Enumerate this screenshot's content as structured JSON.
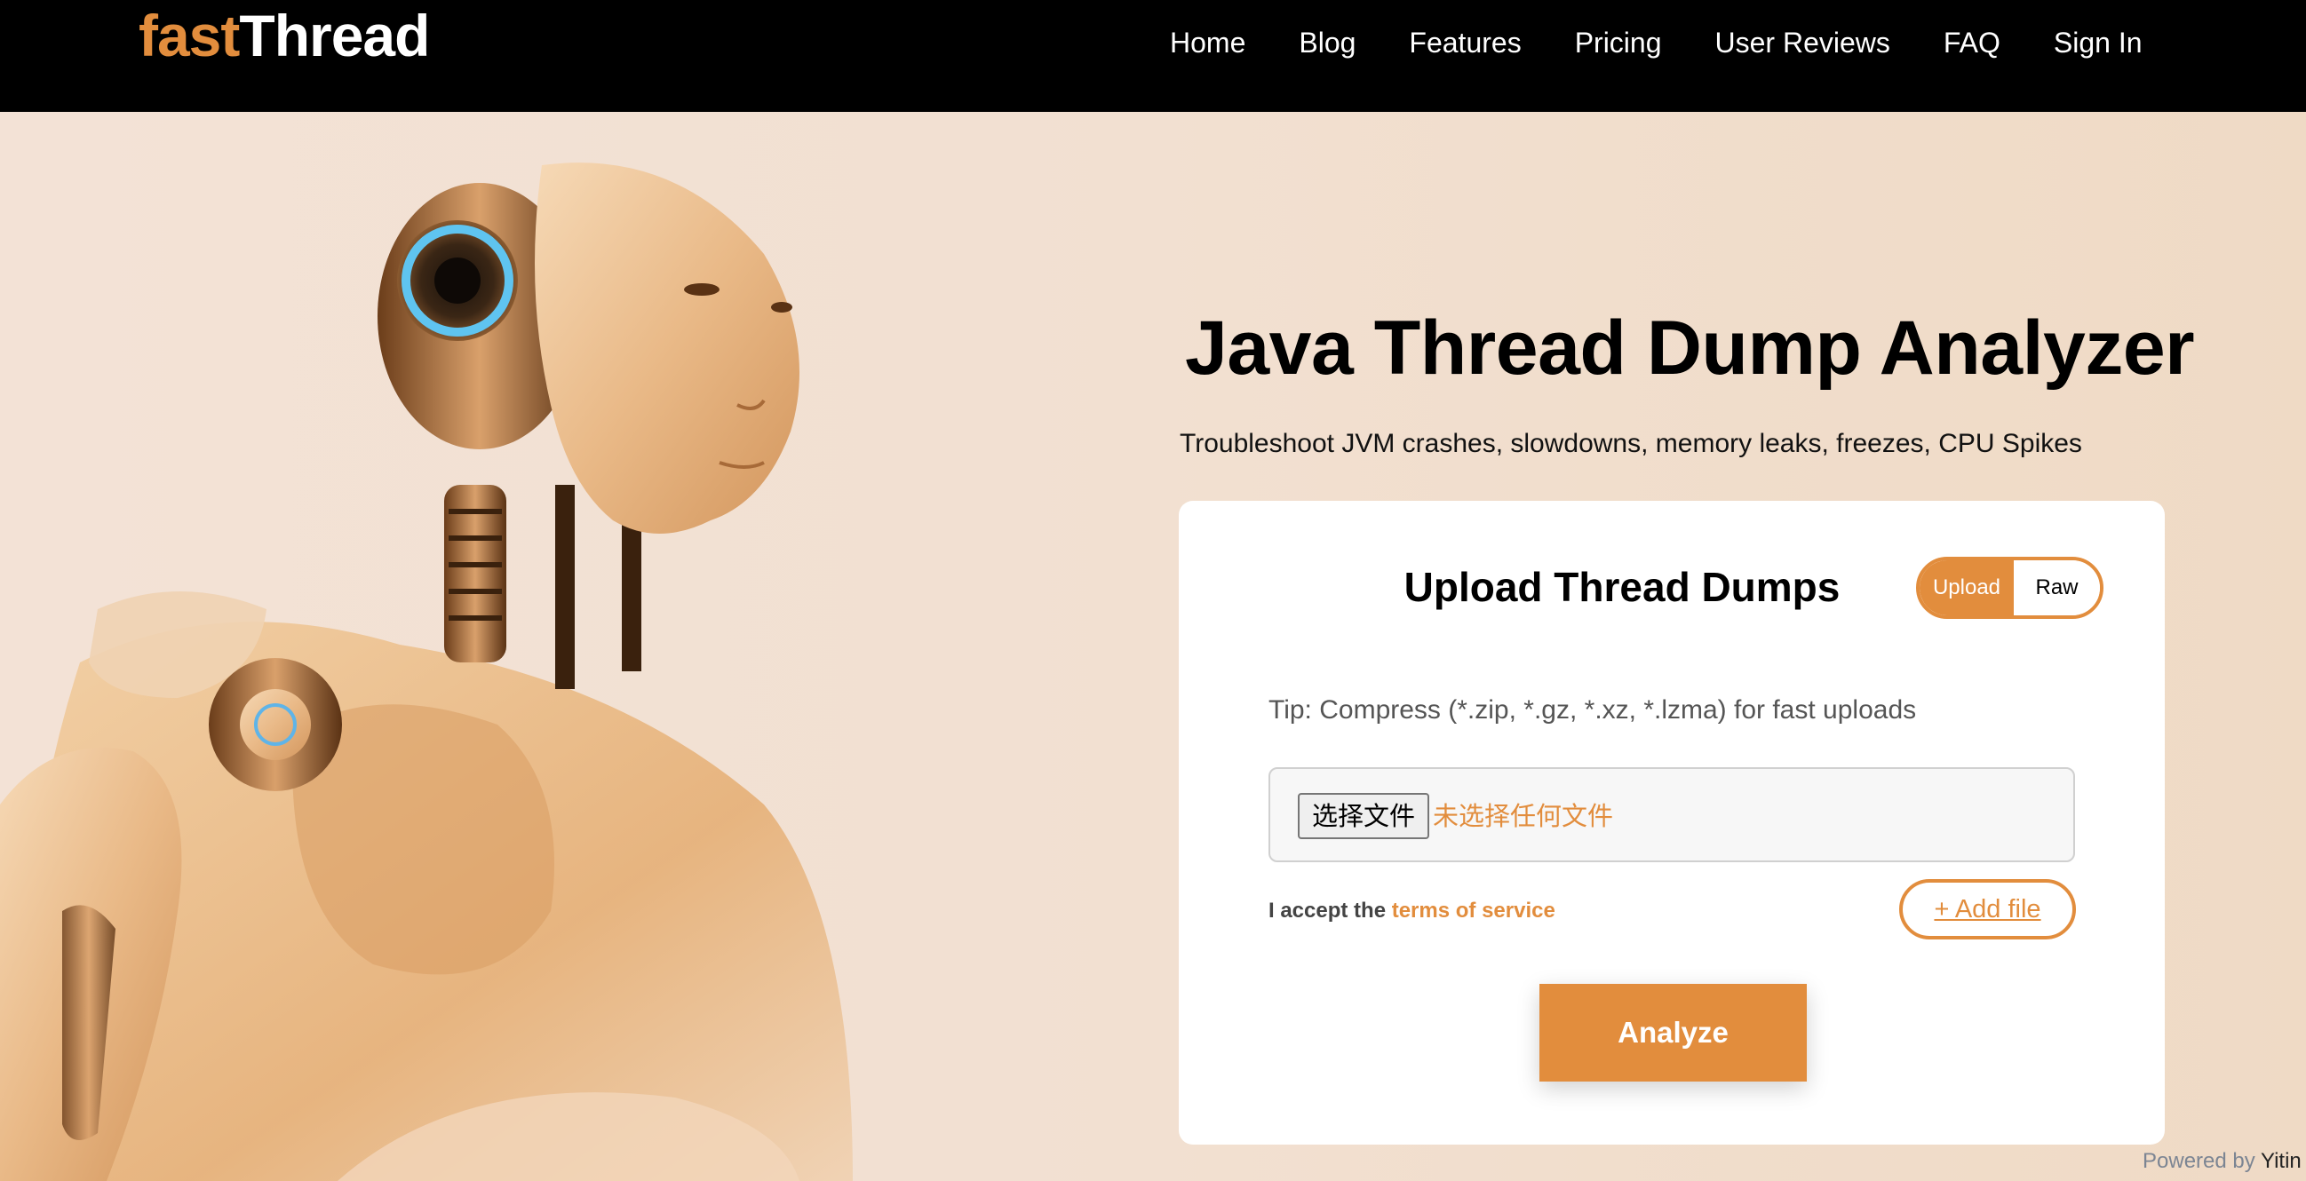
{
  "header": {
    "logo": {
      "part1": "fast",
      "part2": "Thread"
    },
    "nav": [
      {
        "label": "Home"
      },
      {
        "label": "Blog"
      },
      {
        "label": "Features"
      },
      {
        "label": "Pricing"
      },
      {
        "label": "User Reviews"
      },
      {
        "label": "FAQ"
      },
      {
        "label": "Sign In"
      }
    ]
  },
  "hero": {
    "title": "Java Thread Dump Analyzer",
    "subtitle": "Troubleshoot JVM crashes, slowdowns, memory leaks, freezes, CPU Spikes",
    "image": "robot-illustration"
  },
  "upload_card": {
    "title": "Upload Thread Dumps",
    "mode_toggle": {
      "options": [
        "Upload",
        "Raw"
      ],
      "selected": "Upload"
    },
    "tip": "Tip: Compress (*.zip, *.gz, *.xz, *.lzma) for fast uploads",
    "file_input": {
      "button_label": "选择文件",
      "status": "未选择任何文件"
    },
    "accept_prefix": "I accept the",
    "terms_link": "terms of service",
    "add_file_label": "+ Add file",
    "analyze_label": "Analyze"
  },
  "footer": {
    "powered_prefix": "Powered by",
    "powered_brand": "Yitin"
  },
  "colors": {
    "accent": "#e28d3d",
    "header_bg": "#000000",
    "page_bg": "#f1dfd0"
  }
}
